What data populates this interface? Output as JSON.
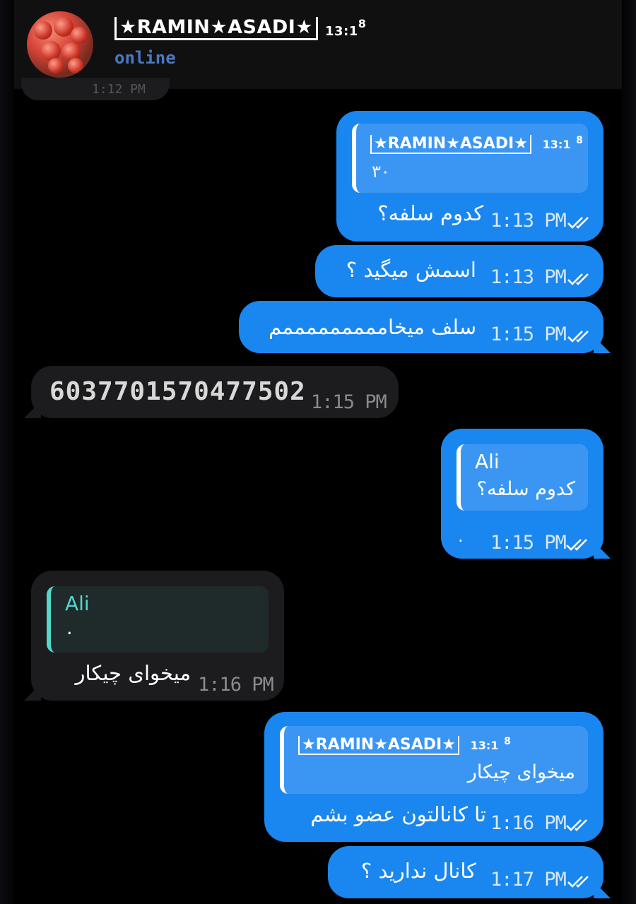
{
  "header": {
    "contact_name": "★RAMIN★ASADI★",
    "name_suffix": "13:1",
    "name_sup": "8",
    "status": "online",
    "partial_time": "1:12 PM"
  },
  "messages": [
    {
      "id": "m1",
      "direction": "outgoing",
      "reply": {
        "name": "★RAMIN★ASADI★",
        "suffix": "13:1",
        "sup": "8",
        "text": "۳۰"
      },
      "text": "کدوم سلفه؟",
      "time": "1:13 PM",
      "status": "read"
    },
    {
      "id": "m2",
      "direction": "outgoing",
      "text": "اسمش میگید ؟",
      "time": "1:13 PM",
      "status": "read"
    },
    {
      "id": "m3",
      "direction": "outgoing",
      "text": "سلف میخامممممممممم",
      "time": "1:15 PM",
      "status": "read"
    },
    {
      "id": "m4",
      "direction": "incoming",
      "text": "6037701570477502",
      "time": "1:15 PM"
    },
    {
      "id": "m5",
      "direction": "outgoing",
      "reply": {
        "name": "Ali",
        "text": "کدوم سلفه؟"
      },
      "text": ".",
      "time": "1:15 PM",
      "status": "read"
    },
    {
      "id": "m6",
      "direction": "incoming",
      "reply": {
        "name": "Ali",
        "text": "."
      },
      "text": "میخوای چیکار",
      "time": "1:16 PM"
    },
    {
      "id": "m7",
      "direction": "outgoing",
      "reply": {
        "name": "★RAMIN★ASADI★",
        "suffix": "13:1",
        "sup": "8",
        "text": "میخوای چیکار"
      },
      "text": "تا کانالتون عضو بشم",
      "time": "1:16 PM",
      "status": "read"
    },
    {
      "id": "m8",
      "direction": "outgoing",
      "text": "کانال ندارید ؟",
      "time": "1:17 PM",
      "status": "read"
    }
  ],
  "icons": {
    "read_status": "double-check-icon",
    "avatar": "tomatoes-avatar"
  },
  "colors": {
    "outgoing_bubble": "#1a86f0",
    "incoming_bubble": "#1c1c1e",
    "status_text": "#4a78c2",
    "reply_bar_incoming": "#54d6cc"
  }
}
